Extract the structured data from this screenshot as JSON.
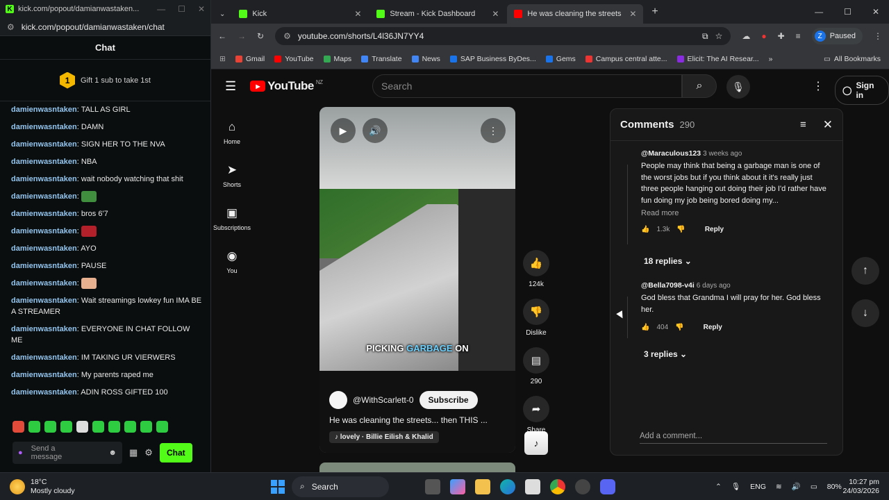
{
  "kick_window": {
    "title": "kick.com/popout/damianwastaken...",
    "url": "kick.com/popout/damianwastaken/chat",
    "header": "Chat",
    "gift": {
      "rank": "1",
      "label": "Gift 1 sub to take 1st"
    },
    "messages": [
      {
        "user": "damienwasntaken",
        "text": "TALL AS GIRL"
      },
      {
        "user": "damienwasntaken",
        "text": "DAMN"
      },
      {
        "user": "damienwasntaken",
        "text": "SIGN HER TO THE NVA"
      },
      {
        "user": "damienwasntaken",
        "text": "NBA"
      },
      {
        "user": "damienwasntaken",
        "text": "wait nobody watching that shit"
      },
      {
        "user": "damienwasntaken",
        "text": ""
      },
      {
        "user": "damienwasntaken",
        "text": "bros 6'7"
      },
      {
        "user": "damienwasntaken",
        "text": ""
      },
      {
        "user": "damienwasntaken",
        "text": "AYO"
      },
      {
        "user": "damienwasntaken",
        "text": "PAUSE"
      },
      {
        "user": "damienwasntaken",
        "text": ""
      },
      {
        "user": "damienwasntaken",
        "text": "Wait streamings lowkey fun IMA BE A STREAMER"
      },
      {
        "user": "damienwasntaken",
        "text": "EVERYONE IN CHAT FOLLOW ME"
      },
      {
        "user": "damienwasntaken",
        "text": "IM TAKING UR VIERWERS"
      },
      {
        "user": "damienwasntaken",
        "text": "My parents raped me"
      },
      {
        "user": "damienwasntaken",
        "text": "ADIN ROSS GIFTED 100"
      }
    ],
    "input_placeholder": "Send a message",
    "chat_button": "Chat"
  },
  "browser": {
    "tabs": [
      {
        "label": "Kick",
        "color": "#53fc18",
        "active": false
      },
      {
        "label": "Stream - Kick Dashboard",
        "color": "#53fc18",
        "active": false
      },
      {
        "label": "He was cleaning the streets",
        "color": "#ff0000",
        "active": true
      }
    ],
    "url": "youtube.com/shorts/L4l36JN7YY4",
    "profile_initial": "Z",
    "profile_status": "Paused",
    "bookmarks": [
      "Gmail",
      "YouTube",
      "Maps",
      "Translate",
      "News",
      "SAP Business ByDes...",
      "Gems",
      "Campus central atte...",
      "Elicit: The AI Resear..."
    ],
    "all_bookmarks": "All Bookmarks"
  },
  "youtube": {
    "logo": "YouTube",
    "region": "NZ",
    "search_placeholder": "Search",
    "sign_in": "Sign in",
    "guide": [
      {
        "label": "Home",
        "icon": "⌂"
      },
      {
        "label": "Shorts",
        "icon": "➤"
      },
      {
        "label": "Subscriptions",
        "icon": "▣"
      },
      {
        "label": "You",
        "icon": "◉"
      }
    ],
    "video": {
      "caption_a": "PICKING ",
      "caption_b": "GARBAGE",
      "caption_c": " ON",
      "channel": "@WithScarlett-0",
      "subscribe": "Subscribe",
      "title": "He was cleaning the streets... then THIS ...",
      "music": "lovely · Billie Eilish & Khalid"
    },
    "actions": {
      "likes": "124k",
      "dislike": "Dislike",
      "comments": "290",
      "share": "Share"
    },
    "comments_panel": {
      "title": "Comments",
      "count": "290",
      "items": [
        {
          "author": "@Maraculous123",
          "time": "3 weeks ago",
          "text": "People may think that being a garbage man is one of the worst jobs but if you think about it it's really just three people hanging out doing their job I'd rather have fun doing my job being bored doing my...",
          "read_more": "Read more",
          "likes": "1.3k",
          "reply": "Reply",
          "replies": "18 replies"
        },
        {
          "author": "@Bella7098-v4i",
          "time": "6 days ago",
          "text": "God bless that Grandma I will pray for her. God bless her.",
          "likes": "404",
          "reply": "Reply",
          "replies": "3 replies"
        }
      ],
      "add_comment": "Add a comment..."
    }
  },
  "taskbar": {
    "temp": "18°C",
    "weather": "Mostly cloudy",
    "search": "Search",
    "lang": "ENG",
    "battery": "80%",
    "time": "10:27 pm",
    "date": "24/03/2026"
  }
}
